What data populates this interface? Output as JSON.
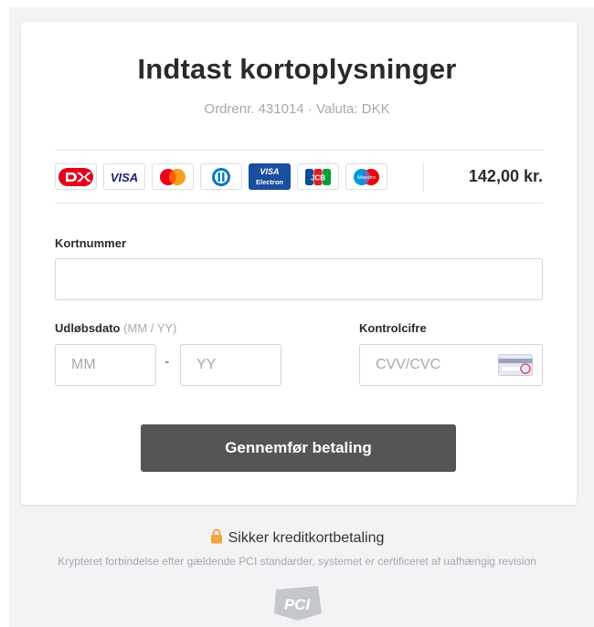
{
  "header": {
    "title": "Indtast kortoplysninger",
    "subtitle": "Ordrenr. 431014 · Valuta: DKK"
  },
  "payment": {
    "amount": "142,00 kr.",
    "card_logos": [
      {
        "name": "dankort",
        "text": ""
      },
      {
        "name": "visa",
        "text": "VISA"
      },
      {
        "name": "mastercard",
        "text": ""
      },
      {
        "name": "diners",
        "text": ""
      },
      {
        "name": "visa-electron",
        "text": "VISA Electron"
      },
      {
        "name": "jcb",
        "text": "JCB"
      },
      {
        "name": "maestro",
        "text": "Maestro"
      }
    ]
  },
  "form": {
    "card_number_label": "Kortnummer",
    "card_number_value": "",
    "expiry_label": "Udløbsdato",
    "expiry_hint": "(MM / YY)",
    "month_placeholder": "MM",
    "year_placeholder": "YY",
    "expiry_separator": "-",
    "cvc_label": "Kontrolcifre",
    "cvc_placeholder": "CVV/CVC",
    "submit_label": "Gennemfør betaling"
  },
  "footer": {
    "secure_text": "Sikker kreditkortbetaling",
    "notice": "Krypteret forbindelse efter gældende PCI standarder, systemet er certificeret af uafhængig revision",
    "pci_logo_text": "PCI"
  },
  "colors": {
    "page_background": "#f3f3f6",
    "button": "#555555",
    "muted_text": "#a8a8ad",
    "lock_icon": "#f2a33a"
  }
}
